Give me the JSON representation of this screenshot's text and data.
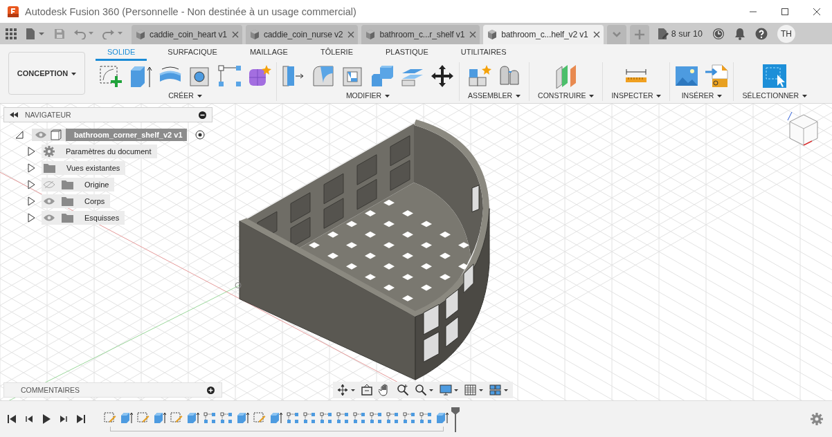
{
  "window": {
    "title": "Autodesk Fusion 360 (Personnelle - Non destinée à un usage commercial)"
  },
  "doc_tabs": [
    {
      "label": "caddie_coin_heart v1",
      "selected": false
    },
    {
      "label": "caddie_coin_nurse v2",
      "selected": false
    },
    {
      "label": "bathroom_c...r_shelf v1",
      "selected": false
    },
    {
      "label": "bathroom_c...helf_v2 v1",
      "selected": true
    }
  ],
  "job_status": "8 sur 10",
  "user_initials": "TH",
  "workspace": "CONCEPTION",
  "ribbon_tabs": [
    {
      "label": "SOLIDE",
      "selected": true
    },
    {
      "label": "SURFACIQUE",
      "selected": false
    },
    {
      "label": "MAILLAGE",
      "selected": false
    },
    {
      "label": "TÔLERIE",
      "selected": false
    },
    {
      "label": "PLASTIQUE",
      "selected": false
    },
    {
      "label": "UTILITAIRES",
      "selected": false
    }
  ],
  "tool_groups": [
    {
      "label": "CRÉER",
      "tools": [
        {
          "kind": "sketch"
        },
        {
          "kind": "extrude"
        },
        {
          "kind": "revolve"
        },
        {
          "kind": "hole"
        },
        {
          "kind": "pattern"
        },
        {
          "kind": "form"
        }
      ]
    },
    {
      "label": "MODIFIER",
      "tools": [
        {
          "kind": "presspull"
        },
        {
          "kind": "fillet"
        },
        {
          "kind": "shell"
        },
        {
          "kind": "combine"
        },
        {
          "kind": "offset"
        },
        {
          "kind": "move"
        }
      ]
    },
    {
      "label": "ASSEMBLER",
      "tools": [
        {
          "kind": "component"
        },
        {
          "kind": "joint"
        }
      ]
    },
    {
      "label": "CONSTRUIRE",
      "tools": [
        {
          "kind": "plane"
        }
      ]
    },
    {
      "label": "INSPECTER",
      "tools": [
        {
          "kind": "measure"
        }
      ]
    },
    {
      "label": "INSÉRER",
      "tools": [
        {
          "kind": "image"
        },
        {
          "kind": "svg"
        }
      ]
    },
    {
      "label": "SÉLECTIONNER",
      "tools": [
        {
          "kind": "select"
        }
      ]
    }
  ],
  "navigator": {
    "title": "NAVIGATEUR",
    "root": {
      "label": "bathroom_corner_shelf_v2 v1",
      "expanded": true,
      "visible": true,
      "children": [
        {
          "label": "Paramètres du document",
          "kind": "settings",
          "expanded": false
        },
        {
          "label": "Vues existantes",
          "kind": "folder",
          "expanded": false
        },
        {
          "label": "Origine",
          "kind": "folder",
          "expanded": false,
          "visible": false
        },
        {
          "label": "Corps",
          "kind": "folder",
          "expanded": false,
          "visible": true
        },
        {
          "label": "Esquisses",
          "kind": "folder",
          "expanded": false,
          "visible": true
        }
      ]
    }
  },
  "comments": {
    "title": "COMMENTAIRES"
  },
  "timeline": [
    {
      "kind": "sketch"
    },
    {
      "kind": "extrude"
    },
    {
      "kind": "sketch"
    },
    {
      "kind": "extrude"
    },
    {
      "kind": "sketch"
    },
    {
      "kind": "extrude"
    },
    {
      "kind": "pattern"
    },
    {
      "kind": "pattern"
    },
    {
      "kind": "extrude"
    },
    {
      "kind": "sketch"
    },
    {
      "kind": "extrude"
    },
    {
      "kind": "pattern"
    },
    {
      "kind": "pattern"
    },
    {
      "kind": "pattern"
    },
    {
      "kind": "pattern"
    },
    {
      "kind": "pattern"
    },
    {
      "kind": "pattern"
    },
    {
      "kind": "pattern"
    },
    {
      "kind": "pattern"
    },
    {
      "kind": "pattern"
    },
    {
      "kind": "extrude"
    }
  ]
}
